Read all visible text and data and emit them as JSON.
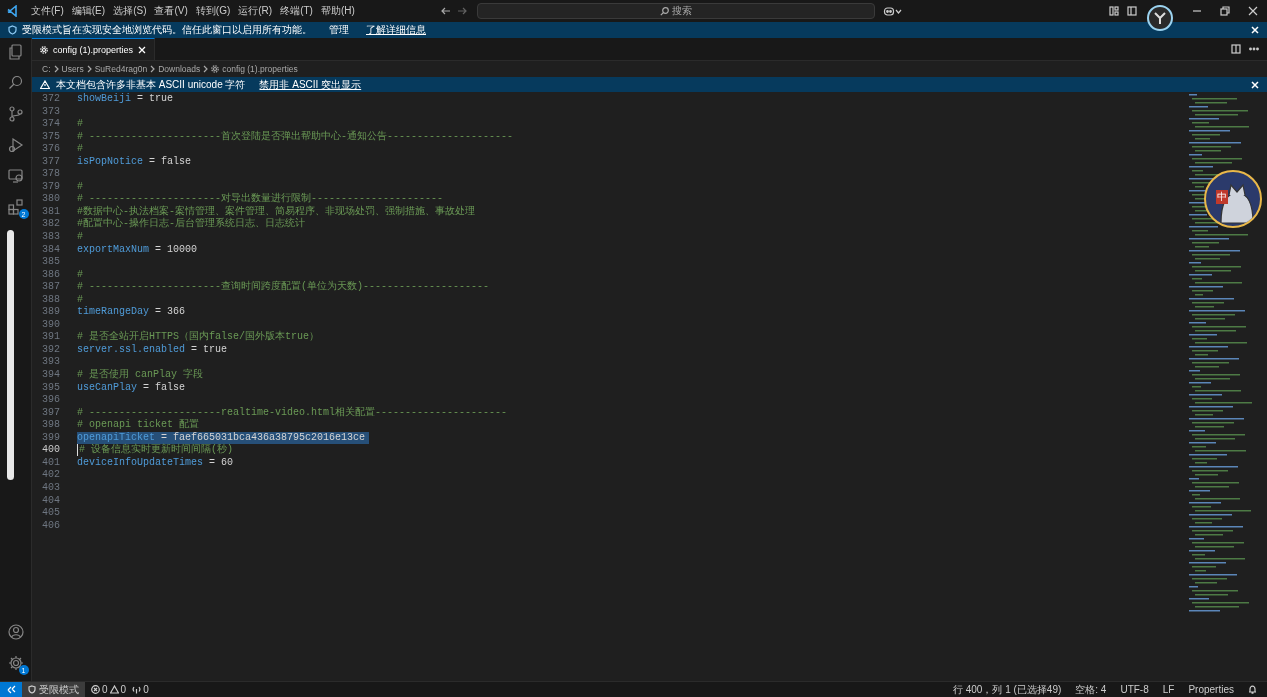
{
  "menu": [
    {
      "label": "文件(F)"
    },
    {
      "label": "编辑(E)"
    },
    {
      "label": "选择(S)"
    },
    {
      "label": "查看(V)"
    },
    {
      "label": "转到(G)"
    },
    {
      "label": "运行(R)"
    },
    {
      "label": "终端(T)"
    },
    {
      "label": "帮助(H)"
    }
  ],
  "search": {
    "placeholder": "搜索"
  },
  "restricted_banner": {
    "message": "受限模式旨在实现安全地浏览代码。信任此窗口以启用所有功能。",
    "links": [
      "管理",
      "了解详细信息"
    ]
  },
  "activity_bar": {
    "items": [
      {
        "kind": "files",
        "selected": false
      },
      {
        "kind": "search",
        "selected": false
      },
      {
        "kind": "source-control",
        "selected": false
      },
      {
        "kind": "run",
        "selected": false
      },
      {
        "kind": "remote",
        "selected": false
      },
      {
        "kind": "extensions",
        "selected": false,
        "badge": "2"
      }
    ],
    "bottom": [
      {
        "kind": "account"
      },
      {
        "kind": "settings",
        "badge": "1"
      }
    ]
  },
  "tabs": [
    {
      "label": "config (1).properties",
      "selected": true
    }
  ],
  "breadcrumbs": [
    "C:",
    "Users",
    "SuRed4rag0n",
    "Downloads",
    "config (1).properties"
  ],
  "unicode_banner": {
    "message": "本文档包含许多非基本 ASCII unicode 字符",
    "link": "禁用非 ASCII 突出显示"
  },
  "lines": [
    {
      "number": "372",
      "kind": "property",
      "key": "showBeiji",
      "operator": "=",
      "value": "true"
    },
    {
      "number": "373",
      "kind": "blank"
    },
    {
      "number": "374",
      "kind": "comment",
      "text": "#"
    },
    {
      "number": "375",
      "kind": "comment",
      "text": "# ----------------------首次登陆是否弹出帮助中心-通知公告---------------------"
    },
    {
      "number": "376",
      "kind": "comment",
      "text": "#"
    },
    {
      "number": "377",
      "kind": "property",
      "key": "isPopNotice",
      "operator": "=",
      "value": "false"
    },
    {
      "number": "378",
      "kind": "blank"
    },
    {
      "number": "379",
      "kind": "comment",
      "text": "#"
    },
    {
      "number": "380",
      "kind": "comment",
      "text": "# ----------------------对导出数量进行限制----------------------"
    },
    {
      "number": "381",
      "kind": "comment",
      "text": "#数据中心-执法档案-案情管理、案件管理、简易程序、非现场处罚、强制措施、事故处理"
    },
    {
      "number": "382",
      "kind": "comment",
      "text": "#配置中心-操作日志-后台管理系统日志、日志统计"
    },
    {
      "number": "383",
      "kind": "comment",
      "text": "#"
    },
    {
      "number": "384",
      "kind": "property",
      "key": "exportMaxNum",
      "operator": "=",
      "value": "10000"
    },
    {
      "number": "385",
      "kind": "blank"
    },
    {
      "number": "386",
      "kind": "comment",
      "text": "#"
    },
    {
      "number": "387",
      "kind": "comment",
      "text": "# ----------------------查询时间跨度配置(单位为天数)---------------------"
    },
    {
      "number": "388",
      "kind": "comment",
      "text": "#"
    },
    {
      "number": "389",
      "kind": "property",
      "key": "timeRangeDay",
      "operator": "=",
      "value": "366"
    },
    {
      "number": "390",
      "kind": "blank"
    },
    {
      "number": "391",
      "kind": "comment",
      "text": "# 是否全站开启HTTPS（国内false/国外版本true）"
    },
    {
      "number": "392",
      "kind": "property",
      "key": "server.ssl.enabled",
      "operator": "=",
      "value": "true"
    },
    {
      "number": "393",
      "kind": "blank"
    },
    {
      "number": "394",
      "kind": "comment",
      "text": "# 是否使用 canPlay 字段"
    },
    {
      "number": "395",
      "kind": "property",
      "key": "useCanPlay",
      "operator": "=",
      "value": "false"
    },
    {
      "number": "396",
      "kind": "blank"
    },
    {
      "number": "397",
      "kind": "comment",
      "text": "# ----------------------realtime-video.html相关配置----------------------"
    },
    {
      "number": "398",
      "kind": "comment",
      "text": "# openapi ticket 配置"
    },
    {
      "number": "399",
      "kind": "property",
      "key": "openapiTicket",
      "operator": "=",
      "value": "faef665031bca436a38795c2016e13ce",
      "selected": true
    },
    {
      "number": "400",
      "kind": "comment",
      "text": "# 设备信息实时更新时间间隔(秒)",
      "current": true
    },
    {
      "number": "401",
      "kind": "property",
      "key": "deviceInfoUpdateTimes",
      "operator": "=",
      "value": "60"
    },
    {
      "number": "402",
      "kind": "blank"
    },
    {
      "number": "403",
      "kind": "blank"
    },
    {
      "number": "404",
      "kind": "blank"
    },
    {
      "number": "405",
      "kind": "blank"
    },
    {
      "number": "406",
      "kind": "blank"
    }
  ],
  "sticker": {
    "text": "中"
  },
  "status_bar": {
    "restricted": "受限模式",
    "errors": "0",
    "warnings": "0",
    "ports": "0",
    "position": "行 400，列 1 (已选择49)",
    "indent": "空格: 4",
    "encoding": "UTF-8",
    "eol": "LF",
    "language": "Properties"
  }
}
